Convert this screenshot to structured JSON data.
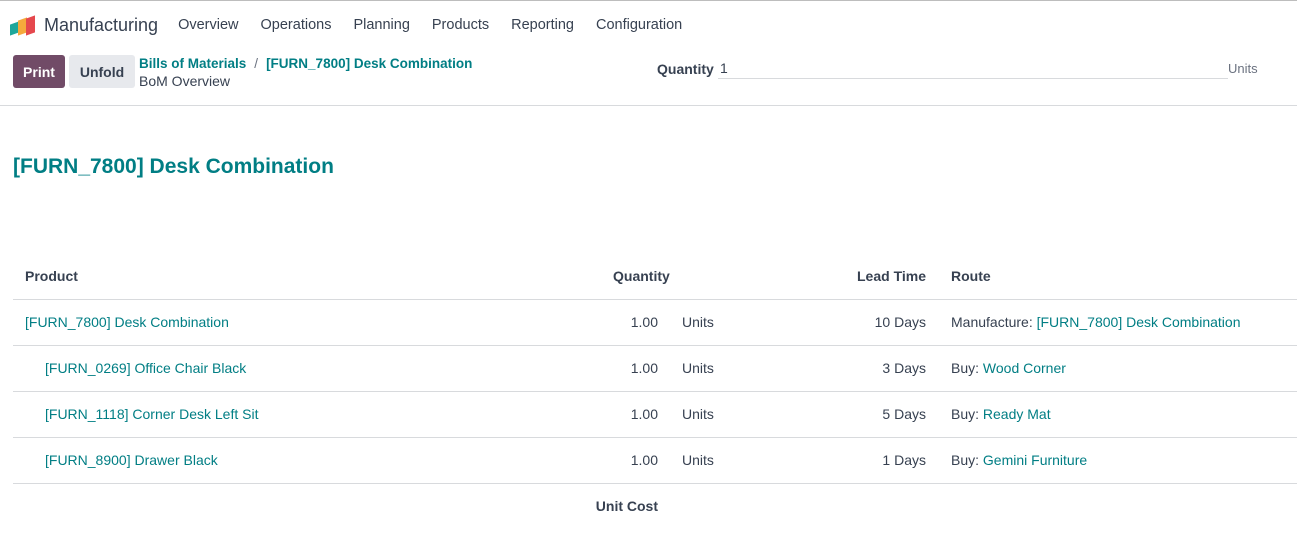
{
  "app": {
    "name": "Manufacturing",
    "icon": "manufacturing-logo-icon",
    "menu": [
      "Overview",
      "Operations",
      "Planning",
      "Products",
      "Reporting",
      "Configuration"
    ]
  },
  "control_panel": {
    "print_label": "Print",
    "unfold_label": "Unfold",
    "breadcrumb": {
      "items": [
        "Bills of Materials",
        "[FURN_7800] Desk Combination"
      ],
      "separator": "/",
      "current": "BoM Overview"
    },
    "quantity": {
      "label": "Quantity",
      "value": "1",
      "unit": "Units"
    }
  },
  "report": {
    "title": "[FURN_7800] Desk Combination",
    "columns": {
      "product": "Product",
      "quantity": "Quantity",
      "lead_time": "Lead Time",
      "route": "Route"
    },
    "rows": [
      {
        "product": "[FURN_7800] Desk Combination",
        "quantity": "1.00",
        "uom": "Units",
        "lead_time": "10 Days",
        "route_type": "Manufacture:",
        "route_name": "[FURN_7800] Desk Combination"
      },
      {
        "product": "[FURN_0269] Office Chair Black",
        "quantity": "1.00",
        "uom": "Units",
        "lead_time": "3 Days",
        "route_type": "Buy:",
        "route_name": "Wood Corner"
      },
      {
        "product": "[FURN_1118] Corner Desk Left Sit",
        "quantity": "1.00",
        "uom": "Units",
        "lead_time": "5 Days",
        "route_type": "Buy:",
        "route_name": "Ready Mat"
      },
      {
        "product": "[FURN_8900] Drawer Black",
        "quantity": "1.00",
        "uom": "Units",
        "lead_time": "1 Days",
        "route_type": "Buy:",
        "route_name": "Gemini Furniture"
      }
    ],
    "footer_label": "Unit Cost"
  },
  "colors": {
    "accent": "#017e84",
    "primary_button": "#714b67"
  }
}
